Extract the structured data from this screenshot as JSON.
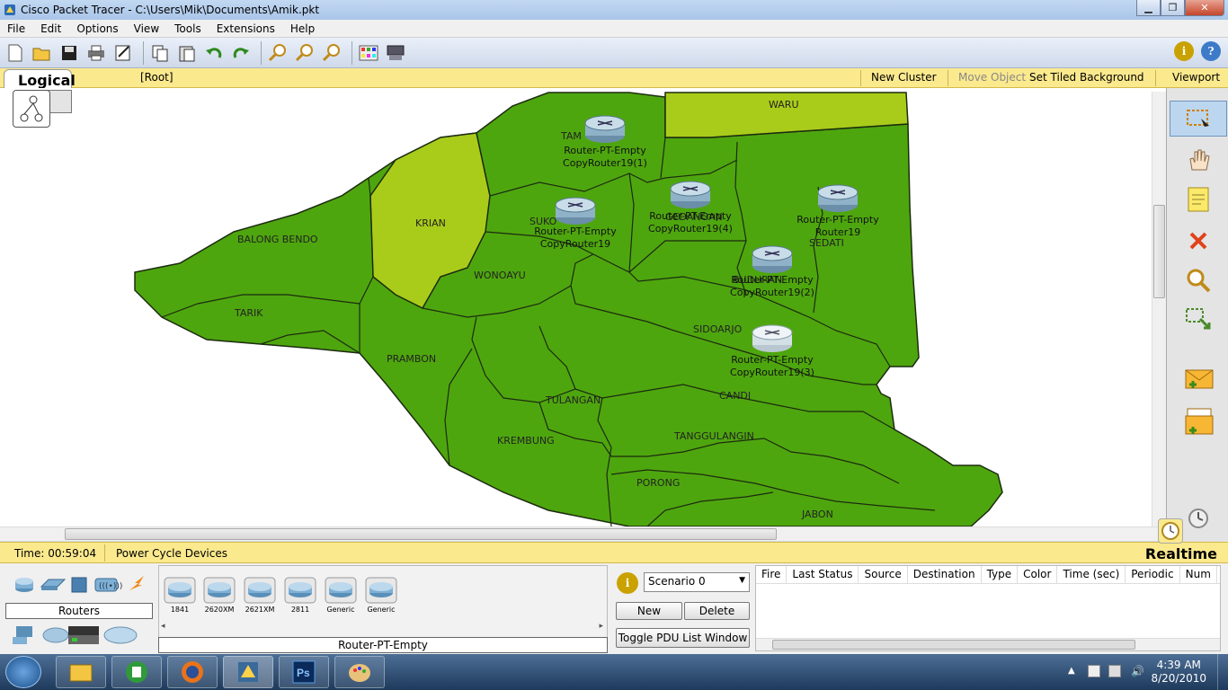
{
  "window": {
    "title": "Cisco Packet Tracer - C:\\Users\\Mik\\Documents\\Amik.pkt"
  },
  "menu": [
    "File",
    "Edit",
    "Options",
    "View",
    "Tools",
    "Extensions",
    "Help"
  ],
  "toolbar": {
    "icons": [
      "new-file-icon",
      "open-file-icon",
      "save-icon",
      "print-icon",
      "activity-wizard-icon",
      "copy-icon",
      "paste-icon",
      "undo-icon",
      "redo-icon",
      "zoom-in-icon",
      "zoom-reset-icon",
      "zoom-out-icon",
      "palette-icon",
      "custom-device-icon"
    ]
  },
  "nav": {
    "tab": "Logical",
    "path": "[Root]",
    "new_cluster": "New Cluster",
    "move_object": "Move Object",
    "set_tiled_background": "Set Tiled Background",
    "viewport": "Viewport"
  },
  "map": {
    "regions": [
      "WARU",
      "TAM",
      "KRIAN",
      "BALONG BENDO",
      "SUKO",
      "GEDANGAN",
      "SEDATI",
      "WONOAYU",
      "TARIK",
      "BUDURAN",
      "SIDOARJO",
      "PRAMBON",
      "TULANGAN",
      "CANDI",
      "KREMBUNG",
      "TANGGULANGIN",
      "PORONG",
      "JABON"
    ],
    "colors": {
      "region_green": "#4ea60e",
      "region_lime": "#a9cc1a",
      "border": "#1c2b10"
    }
  },
  "routers": [
    {
      "line1": "Router-PT-Empty",
      "line2": "CopyRouter19(1)"
    },
    {
      "line1": "Router-PT-Empty",
      "line2": "CopyRouter19(4)"
    },
    {
      "line1": "Router-PT-Empty",
      "line2": "Router19"
    },
    {
      "line1": "Router-PT-Empty",
      "line2": "CopyRouter19"
    },
    {
      "line1": "Router-PT-Empty",
      "line2": "CopyRouter19(2)"
    },
    {
      "line1": "Router-PT-Empty",
      "line2": "CopyRouter19(3)"
    }
  ],
  "right_tools": [
    "select-tool",
    "hand-tool",
    "note-tool",
    "delete-tool",
    "inspect-tool",
    "resize-tool",
    "simple-pdu-tool",
    "complex-pdu-tool"
  ],
  "status": {
    "time": "Time: 00:59:04",
    "power_cycle": "Power Cycle Devices",
    "mode": "Realtime"
  },
  "devices": {
    "category_label": "Routers",
    "items": [
      "1841",
      "2620XM",
      "2621XM",
      "2811",
      "Generic",
      "Generic"
    ],
    "selected_name": "Router-PT-Empty"
  },
  "scenario": {
    "selected": "Scenario 0",
    "new": "New",
    "delete": "Delete",
    "toggle": "Toggle PDU List Window"
  },
  "pdu_columns": [
    "Fire",
    "Last Status",
    "Source",
    "Destination",
    "Type",
    "Color",
    "Time (sec)",
    "Periodic",
    "Num"
  ],
  "taskbar": {
    "apps": [
      "start-button",
      "file-explorer",
      "camtasia",
      "firefox",
      "packet-tracer",
      "photoshop",
      "paint"
    ],
    "time": "4:39 AM",
    "date": "8/20/2010"
  }
}
